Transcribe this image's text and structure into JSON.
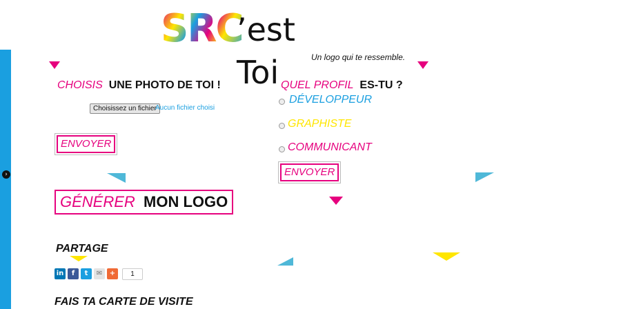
{
  "brand": {
    "logo_src": "SRC",
    "logo_rest": "’est Toi",
    "tagline": "Un logo qui te ressemble."
  },
  "photo_section": {
    "heading_accent": "CHOISIS",
    "heading_main": "UNE PHOTO DE TOI !",
    "file_button": "Choisissez un fichier",
    "file_status": "Aucun fichier choisi",
    "submit": "ENVOYER"
  },
  "profile_section": {
    "heading_accent": "QUEL PROFIL",
    "heading_main": "ES-TU ?",
    "options": [
      {
        "label": "DÉVELOPPEUR",
        "color": "#1a9fe0"
      },
      {
        "label": "GRAPHISTE",
        "color": "#ffe600"
      },
      {
        "label": "COMMUNICANT",
        "color": "#e6007e"
      }
    ],
    "submit": "ENVOYER"
  },
  "generate": {
    "accent": "GÉNÉRER",
    "main": "MON LOGO"
  },
  "share": {
    "heading": "PARTAGE",
    "icons": [
      {
        "name": "linkedin-icon",
        "glyph": "in",
        "color": "#0077b5"
      },
      {
        "name": "facebook-icon",
        "glyph": "f",
        "color": "#3b5998"
      },
      {
        "name": "twitter-icon",
        "glyph": "t",
        "color": "#1a9fe0"
      },
      {
        "name": "email-icon",
        "glyph": "✉",
        "color": "#d8d8d8"
      },
      {
        "name": "more-share-icon",
        "glyph": "+",
        "color": "#f06a35"
      }
    ],
    "count": "1"
  },
  "card": {
    "heading": "FAIS TA CARTE DE VISITE"
  },
  "colors": {
    "magenta": "#e6007e",
    "cyan": "#1a9fe0",
    "yellow": "#ffe600"
  }
}
